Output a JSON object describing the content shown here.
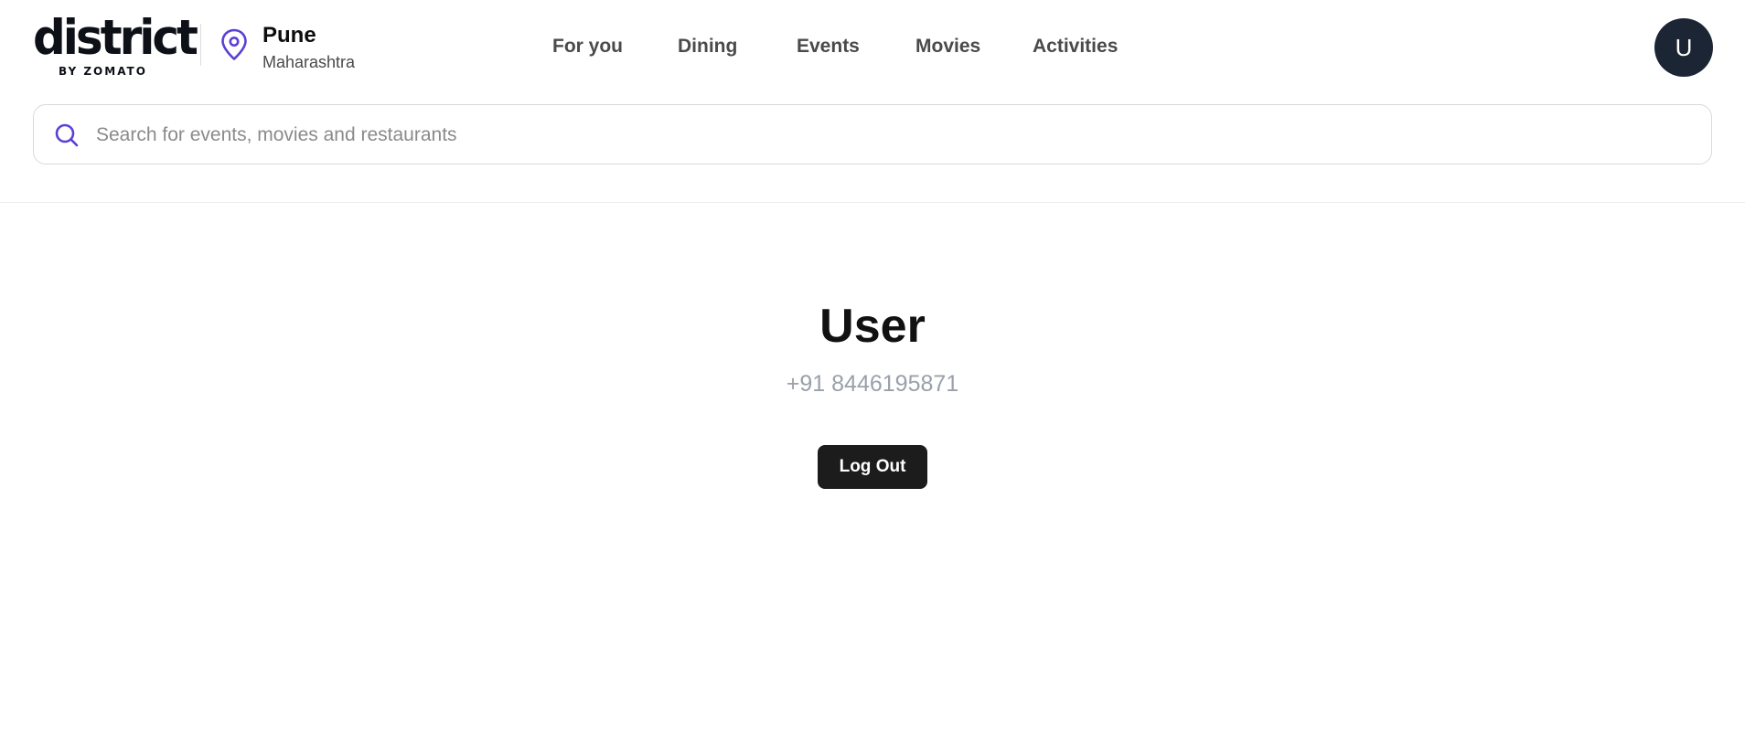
{
  "brand": {
    "logo_text": "district",
    "logo_subtitle": "BY ZOMATO"
  },
  "location": {
    "icon": "map-pin-icon",
    "city": "Pune",
    "state": "Maharashtra"
  },
  "nav": {
    "items": [
      {
        "label": "For you"
      },
      {
        "label": "Dining"
      },
      {
        "label": "Events"
      },
      {
        "label": "Movies"
      },
      {
        "label": "Activities"
      }
    ]
  },
  "avatar": {
    "initial": "U"
  },
  "search": {
    "icon": "search-icon",
    "placeholder": "Search for events, movies and restaurants",
    "value": ""
  },
  "profile": {
    "name": "User",
    "phone": "+91 8446195871",
    "logout_label": "Log Out"
  },
  "colors": {
    "accent": "#5b3fd6",
    "avatar_bg": "#1c2533",
    "button_bg": "#1c1c1c",
    "muted_text": "#9aa0aa"
  }
}
